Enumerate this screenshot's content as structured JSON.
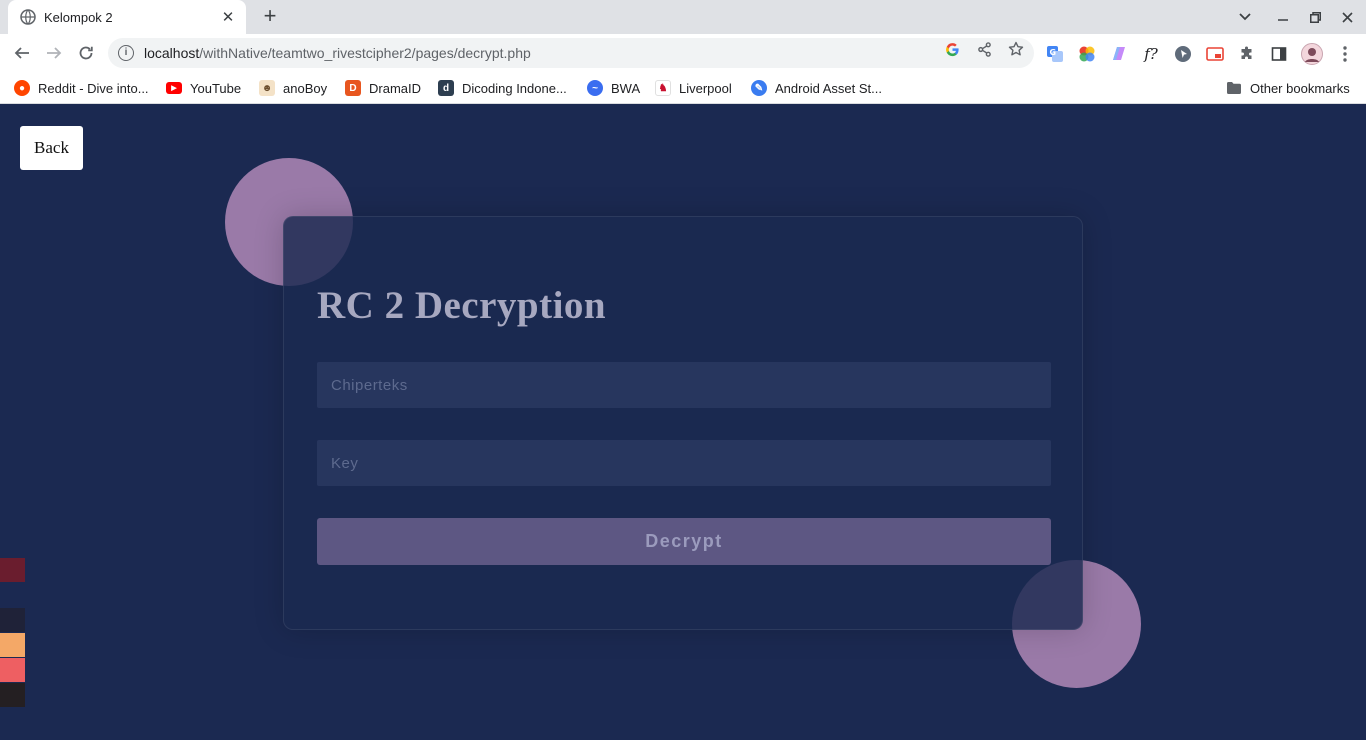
{
  "browser": {
    "tab_title": "Kelompok 2",
    "tab_close": "✕",
    "new_tab": "+",
    "url_host": "localhost",
    "url_path": "/withNative/teamtwo_rivestcipher2/pages/decrypt.php",
    "window_controls": [
      "minimize-icon",
      "restore-icon",
      "close-icon"
    ]
  },
  "bookmarks": {
    "items": [
      {
        "label": "Reddit - Dive into...",
        "icon": "reddit-icon",
        "color": "#ff4500"
      },
      {
        "label": "YouTube",
        "icon": "youtube-icon",
        "color": "#ff0000"
      },
      {
        "label": "anoBoy",
        "icon": "anoboy-icon",
        "color": "#6b4e2e"
      },
      {
        "label": "DramaID",
        "icon": "dramaid-icon",
        "color": "#e8561f"
      },
      {
        "label": "Dicoding Indone...",
        "icon": "dicoding-icon",
        "color": "#2d3e50"
      },
      {
        "label": "BWA",
        "icon": "bwa-icon",
        "color": "#3a6df0"
      },
      {
        "label": "Liverpool",
        "icon": "liverpool-icon",
        "color": "#c8102e"
      },
      {
        "label": "Android Asset St...",
        "icon": "android-asset-studio-icon",
        "color": "#3a7cf0"
      }
    ],
    "other": "Other bookmarks"
  },
  "page": {
    "back_label": "Back",
    "title": "RC 2 Decryption",
    "ciphertext_placeholder": "Chiperteks",
    "key_placeholder": "Key",
    "submit_label": "Decrypt"
  },
  "colors": {
    "background": "#1b2951",
    "circle": "#9a7aa8",
    "button": "#5d5783",
    "swatches": [
      "#6a1d2e",
      "#1f2238",
      "#f4a867",
      "#ee5f62",
      "#241f22"
    ]
  }
}
